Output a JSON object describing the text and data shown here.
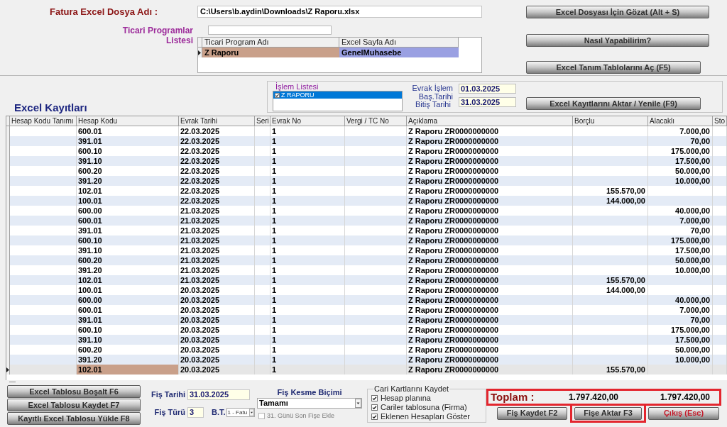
{
  "file_section": {
    "label": "Fatura Excel Dosya Adı :",
    "path": "C:\\Users\\b.aydin\\Downloads\\Z Raporu.xlsx"
  },
  "programs": {
    "label": "Ticari Programlar Listesi",
    "columns": [
      "Ticari Program Adı",
      "Excel Sayfa Adı"
    ],
    "rows": [
      {
        "name": "Z Raporu",
        "sheet": "GenelMuhasebe",
        "selected": true
      }
    ]
  },
  "top_buttons": [
    "Excel Dosyası İçin Gözat (Alt + S)",
    "Nasıl Yapabilirim?",
    "Excel Tanım Tablolarını Aç (F5)"
  ],
  "section_title": "Excel Kayıtları",
  "process_list": {
    "label": "İşlem Listesi",
    "items": [
      {
        "label": "Z RAPORU",
        "checked": true,
        "selected": true
      }
    ]
  },
  "date_range": {
    "start_label": "Evrak İşlem Baş.Tarihi",
    "start": "01.03.2025",
    "end_label": "Bitiş Tarihi",
    "end": "31.03.2025"
  },
  "refresh_button": "Excel Kayıtlarını Aktar / Yenile (F9)",
  "table": {
    "columns": [
      "Hesap Kodu Tanımı",
      "Hesap Kodu",
      "Evrak Tarihi",
      "Seri",
      "Evrak No",
      "Vergi / TC No",
      "Açıklama",
      "Borçlu",
      "Alacaklı",
      "Sto"
    ],
    "rows": [
      {
        "account_code": "600.01",
        "date": "22.03.2025",
        "doc_no": "1",
        "description": "Z Raporu ZR0000000000",
        "credit": "7.000,00",
        "selected": false
      },
      {
        "account_code": "391.01",
        "date": "22.03.2025",
        "doc_no": "1",
        "description": "Z Raporu ZR0000000000",
        "credit": "70,00",
        "selected": false
      },
      {
        "account_code": "600.10",
        "date": "22.03.2025",
        "doc_no": "1",
        "description": "Z Raporu ZR0000000000",
        "credit": "175.000,00",
        "selected": false
      },
      {
        "account_code": "391.10",
        "date": "22.03.2025",
        "doc_no": "1",
        "description": "Z Raporu ZR0000000000",
        "credit": "17.500,00",
        "selected": false
      },
      {
        "account_code": "600.20",
        "date": "22.03.2025",
        "doc_no": "1",
        "description": "Z Raporu ZR0000000000",
        "credit": "50.000,00",
        "selected": false
      },
      {
        "account_code": "391.20",
        "date": "22.03.2025",
        "doc_no": "1",
        "description": "Z Raporu ZR0000000000",
        "credit": "10.000,00",
        "selected": false
      },
      {
        "account_code": "102.01",
        "date": "22.03.2025",
        "doc_no": "1",
        "description": "Z Raporu ZR0000000000",
        "debit": "155.570,00",
        "selected": false
      },
      {
        "account_code": "100.01",
        "date": "22.03.2025",
        "doc_no": "1",
        "description": "Z Raporu ZR0000000000",
        "debit": "144.000,00",
        "selected": false
      },
      {
        "account_code": "600.00",
        "date": "21.03.2025",
        "doc_no": "1",
        "description": "Z Raporu ZR0000000000",
        "credit": "40.000,00",
        "selected": false
      },
      {
        "account_code": "600.01",
        "date": "21.03.2025",
        "doc_no": "1",
        "description": "Z Raporu ZR0000000000",
        "credit": "7.000,00",
        "selected": false
      },
      {
        "account_code": "391.01",
        "date": "21.03.2025",
        "doc_no": "1",
        "description": "Z Raporu ZR0000000000",
        "credit": "70,00",
        "selected": false
      },
      {
        "account_code": "600.10",
        "date": "21.03.2025",
        "doc_no": "1",
        "description": "Z Raporu ZR0000000000",
        "credit": "175.000,00",
        "selected": false
      },
      {
        "account_code": "391.10",
        "date": "21.03.2025",
        "doc_no": "1",
        "description": "Z Raporu ZR0000000000",
        "credit": "17.500,00",
        "selected": false
      },
      {
        "account_code": "600.20",
        "date": "21.03.2025",
        "doc_no": "1",
        "description": "Z Raporu ZR0000000000",
        "credit": "50.000,00",
        "selected": false
      },
      {
        "account_code": "391.20",
        "date": "21.03.2025",
        "doc_no": "1",
        "description": "Z Raporu ZR0000000000",
        "credit": "10.000,00",
        "selected": false
      },
      {
        "account_code": "102.01",
        "date": "21.03.2025",
        "doc_no": "1",
        "description": "Z Raporu ZR0000000000",
        "debit": "155.570,00",
        "selected": false
      },
      {
        "account_code": "100.01",
        "date": "20.03.2025",
        "doc_no": "1",
        "description": "Z Raporu ZR0000000000",
        "debit": "144.000,00",
        "selected": false
      },
      {
        "account_code": "600.00",
        "date": "20.03.2025",
        "doc_no": "1",
        "description": "Z Raporu ZR0000000000",
        "credit": "40.000,00",
        "selected": false
      },
      {
        "account_code": "600.01",
        "date": "20.03.2025",
        "doc_no": "1",
        "description": "Z Raporu ZR0000000000",
        "credit": "7.000,00",
        "selected": false
      },
      {
        "account_code": "391.01",
        "date": "20.03.2025",
        "doc_no": "1",
        "description": "Z Raporu ZR0000000000",
        "credit": "70,00",
        "selected": false
      },
      {
        "account_code": "600.10",
        "date": "20.03.2025",
        "doc_no": "1",
        "description": "Z Raporu ZR0000000000",
        "credit": "175.000,00",
        "selected": false
      },
      {
        "account_code": "391.10",
        "date": "20.03.2025",
        "doc_no": "1",
        "description": "Z Raporu ZR0000000000",
        "credit": "17.500,00",
        "selected": false
      },
      {
        "account_code": "600.20",
        "date": "20.03.2025",
        "doc_no": "1",
        "description": "Z Raporu ZR0000000000",
        "credit": "50.000,00",
        "selected": false
      },
      {
        "account_code": "391.20",
        "date": "20.03.2025",
        "doc_no": "1",
        "description": "Z Raporu ZR0000000000",
        "credit": "10.000,00",
        "selected": false
      },
      {
        "account_code": "102.01",
        "date": "20.03.2025",
        "doc_no": "1",
        "description": "Z Raporu ZR0000000000",
        "debit": "155.570,00",
        "selected": true
      }
    ]
  },
  "table_buttons": [
    "Excel Tablosu Boşalt F6",
    "Excel Tablosu Kaydet F7",
    "Kayıtlı Excel Tablosu Yükle F8"
  ],
  "voucher": {
    "date_label": "Fiş Tarihi",
    "date": "31.03.2025",
    "type_label": "Fiş Türü",
    "type": "3",
    "bt_label": "B.T.",
    "bt_value": "1 - Fatu",
    "split_label": "Fiş Kesme Biçimi",
    "split_value": "Tamamı",
    "last_day": {
      "label": "31. Günü Son Fişe Ekle",
      "checked": false,
      "disabled": true
    }
  },
  "cari_cards": {
    "title": "Cari Kartlarını Kaydet",
    "options": [
      {
        "label": "Hesap planına",
        "checked": true
      },
      {
        "label": "Cariler tablosuna (Firma)",
        "checked": true
      },
      {
        "label": "Eklenen Hesapları Göster",
        "checked": true
      }
    ]
  },
  "totals": {
    "label": "Toplam :",
    "debit": "1.797.420,00",
    "credit": "1.797.420,00",
    "highlighted": true
  },
  "action_buttons": [
    {
      "label": "Fiş Kaydet F2",
      "kind": "normal",
      "highlighted": false
    },
    {
      "label": "Fişe Aktar F3",
      "kind": "normal",
      "highlighted": true
    },
    {
      "label": "Çıkış (Esc)",
      "kind": "exit",
      "highlighted": false
    }
  ]
}
